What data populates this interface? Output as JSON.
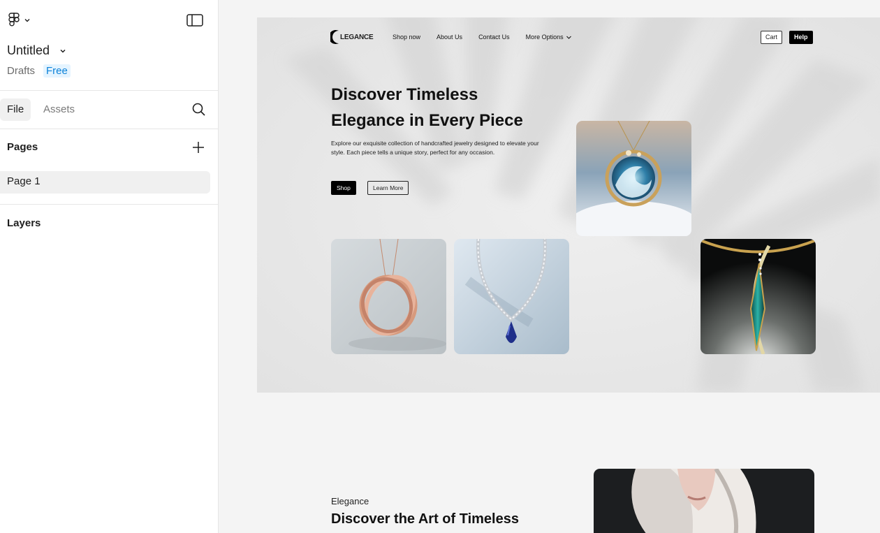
{
  "sidebar": {
    "file_name": "Untitled",
    "location": "Drafts",
    "plan_badge": "Free",
    "tabs": [
      {
        "label": "File",
        "active": true
      },
      {
        "label": "Assets",
        "active": false
      }
    ],
    "pages_label": "Pages",
    "pages": [
      {
        "label": "Page 1",
        "selected": true
      }
    ],
    "layers_label": "Layers",
    "icons": [
      "figma-logo-icon",
      "chevron-down-icon",
      "sidebar-toggle-icon",
      "search-icon",
      "plus-icon"
    ]
  },
  "design": {
    "nav": {
      "logo_text": "LEGANCE",
      "links": [
        "Shop now",
        "About Us",
        "Contact Us",
        "More Options"
      ],
      "cart_label": "Cart",
      "help_label": "Help"
    },
    "hero": {
      "headline_line1": "Discover Timeless",
      "headline_line2": "Elegance in Every Piece",
      "subtext": "Explore our exquisite collection of handcrafted jewelry designed to elevate your style. Each piece tells a unique story, perfect for any occasion.",
      "shop_label": "Shop",
      "learn_more_label": "Learn More"
    },
    "section2": {
      "eyebrow": "Elegance",
      "title": "Discover the Art of Timeless"
    }
  },
  "colors": {
    "accent_blue": "#0d82d9",
    "badge_bg": "#e5f4ff",
    "hero_bg": "#e9e9e9",
    "canvas_bg": "#f4f4f4"
  }
}
